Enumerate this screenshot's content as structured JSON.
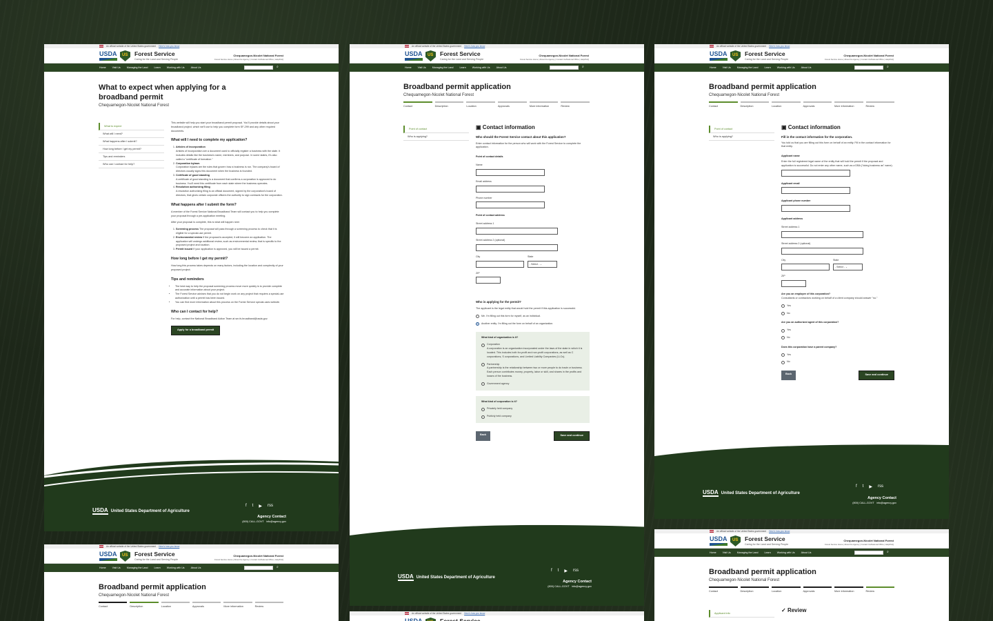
{
  "site": {
    "banner": "An official website of the United States government",
    "banner_link": "Here's how you know",
    "usda": "USDA",
    "fs_title": "Forest Service",
    "fs_tag": "Caring for the Land and Serving People",
    "forest": "Chequamegon-Nicolet National Forest",
    "forest_links": "Forest Service Home | About the Agency | Contact Us/National Office | Help/FAQ",
    "nav": [
      "Home",
      "Visit Us",
      "Managing the Land",
      "Learn",
      "Working with Us",
      "About Us"
    ]
  },
  "p1": {
    "title": "What to expect when applying for a broadband permit",
    "sub": "Chequamegon-Nicolet National Forest",
    "side": [
      "What to expect",
      "What will I need?",
      "What happens after I submit?",
      "How long before I get my permit?",
      "Tips and reminders",
      "Who can I contact for help?"
    ],
    "intro": "This website will help you start your broadband permit proposal. You'll provide details about your broadband project, which we'll use to help you complete form SF-299 and any other required documents.",
    "h_need": "What will I need to complete my application?",
    "needs": [
      {
        "t": "Articles of incorporation",
        "d": "Articles of incorporation are a document used to officially register a business with the state. It includes details like the business's name, members, and purpose. In some states, it's also called a \"certificate of formation.\""
      },
      {
        "t": "Corporation bylaws",
        "d": "Corporation bylaws are the rules that govern how a business is run. The company's board of directors usually signs this document when the business is founded."
      },
      {
        "t": "Certificate of good standing",
        "d": "A certificate of good standing is a document that confirms a corporation is approved to do business. You'll need this certificate from each state where the business operates."
      },
      {
        "t": "Resolution authorizing filing",
        "d": "A resolution authorizing filing is an official document, signed by the corporation's board of directors, that gives certain corporate officers the authority to sign contracts for the corporation."
      }
    ],
    "h_after": "What happens after I submit the form?",
    "after1": "A member of the Forest Service National Broadband Team will contact you to help you complete your proposal through a pre-application meeting.",
    "after2": "After your proposal is complete, this is what will happen next:",
    "after_steps": [
      {
        "t": "Screening process",
        "d": "The proposal will pass through a screening process to check that it is eligible for a special-use permit."
      },
      {
        "t": "Environmental review",
        "d": "If the proposal is accepted, it will become an application. The application will undergo additional review, such as environmental review, that is specific to the proposed project and location."
      },
      {
        "t": "Permit issued",
        "d": "If your application is approved, you will be issued a permit."
      }
    ],
    "h_long": "How long before I get my permit?",
    "long": "How long this process takes depends on many factors, including the location and complexity of your proposed project.",
    "h_tips": "Tips and reminders",
    "tips": [
      "The best way to help the proposal screening process move more quickly is to provide complete and accurate information about your project.",
      "The Forest Service advises that you do not begin work on any project that requires a special-use authorization until a permit has been issued.",
      "You can find more information about this process on the Forest Service special-uses website."
    ],
    "h_contact": "Who can I contact for help?",
    "contact": "For help, contact the National Broadband Action Team at sm.fs.broadband@usda.gov.",
    "cta": "Apply for a broadband permit"
  },
  "app": {
    "title": "Broadband permit application",
    "sub": "Chequamegon-Nicolet National Forest",
    "steps": [
      "Contact",
      "Description",
      "Location",
      "Approvals",
      "More information",
      "Review"
    ]
  },
  "p2": {
    "side": [
      "Point of contact",
      "Who is applying?"
    ],
    "h": "Contact information",
    "q": "Who should the Forest Service contact about this application?",
    "qd": "Enter contact information for the person who will work with the Forest Service to complete the application.",
    "poc": "Point of contact details",
    "name": "Name",
    "email": "Email address",
    "phone": "Phone number",
    "addr": "Point of contact address",
    "street1": "Street address 1",
    "street2": "Street address 2 (optional)",
    "city": "City",
    "state": "State",
    "select": "- Select -",
    "zip": "ZIP",
    "who_h": "Who is applying for the permit?",
    "who_d": "The applicant is the legal entity that would hold the permit if this application is successful.",
    "opt_me": "Me. I'm filling out this form for myself, as an individual.",
    "opt_other": "Another entity. I'm filling out the form on behalf of an organization.",
    "org_q": "What kind of organization is it?",
    "org": [
      {
        "t": "Corporation",
        "d": "A corporation is an organization incorporated under the laws of the state in which it is located. This includes both for-profit and non-profit corporations, as well as C corporations, S corporations, and Limited Liability Companies (LLCs)."
      },
      {
        "t": "Partnership",
        "d": "A partnership is the relationship between two or more people to do trade or business. Each person contributes money, property, labor or skill, and shares in the profits and losses of the business."
      },
      {
        "t": "Government agency",
        "d": ""
      }
    ],
    "corp_q": "What kind of corporation is it?",
    "corp": [
      "Privately held company",
      "Publicly held company"
    ],
    "back": "Back",
    "save": "Save and continue"
  },
  "p3": {
    "h": "Contact information",
    "q": "Fill in the contact information for the corporation.",
    "qd": "You told us that you are filling out this form on behalf of an entity. Fill in the contact information for that entity.",
    "an": "Applicant name",
    "and": "Enter the full registered legal name of the entity that will hold the permit if the proposal and application is successful. Do not enter any other name, such as a DBA (\"doing business as\" name).",
    "ae": "Applicant email",
    "ap": "Applicant phone number",
    "aa": "Applicant address",
    "q1": "Are you an employee of this corporation?",
    "q1d": "Consultants or contractors working on behalf of a client company should answer \"no.\"",
    "q2": "Are you an authorized agent of this corporation?",
    "q3": "Does this corporation have a parent company?",
    "yes": "Yes",
    "no": "No"
  },
  "p5": {
    "side": "Applicant info",
    "h": "Review"
  },
  "footer": {
    "usda": "United States Department of Agriculture",
    "agency": "Agency Contact",
    "phone": "(800) CALL-GOVT",
    "email": "info@agency.gov",
    "social": [
      "f",
      "t",
      "▶",
      "rss"
    ]
  },
  "colors": {
    "green": "#2b4523",
    "accent": "#5b8c2a",
    "footer": "#213a1c"
  }
}
